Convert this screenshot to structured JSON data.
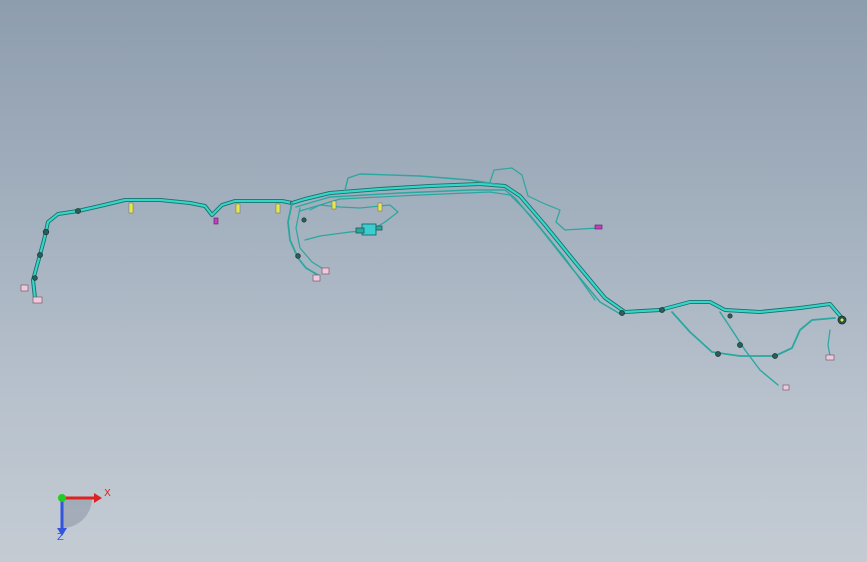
{
  "view": {
    "background_top": "#8e9dae",
    "background_bottom": "#c4cbd3",
    "harness_color": "#33d6c9"
  },
  "triad": {
    "x_label": "X",
    "z_label": "Z",
    "x_color": "#dd2222",
    "y_color": "#22cc22",
    "z_color": "#3355dd"
  },
  "components": {
    "connector_color": "#f0c8dc",
    "clip_color": "#e8e84a",
    "marker_color": "#c040c0",
    "module_color": "#3ccdd0"
  }
}
